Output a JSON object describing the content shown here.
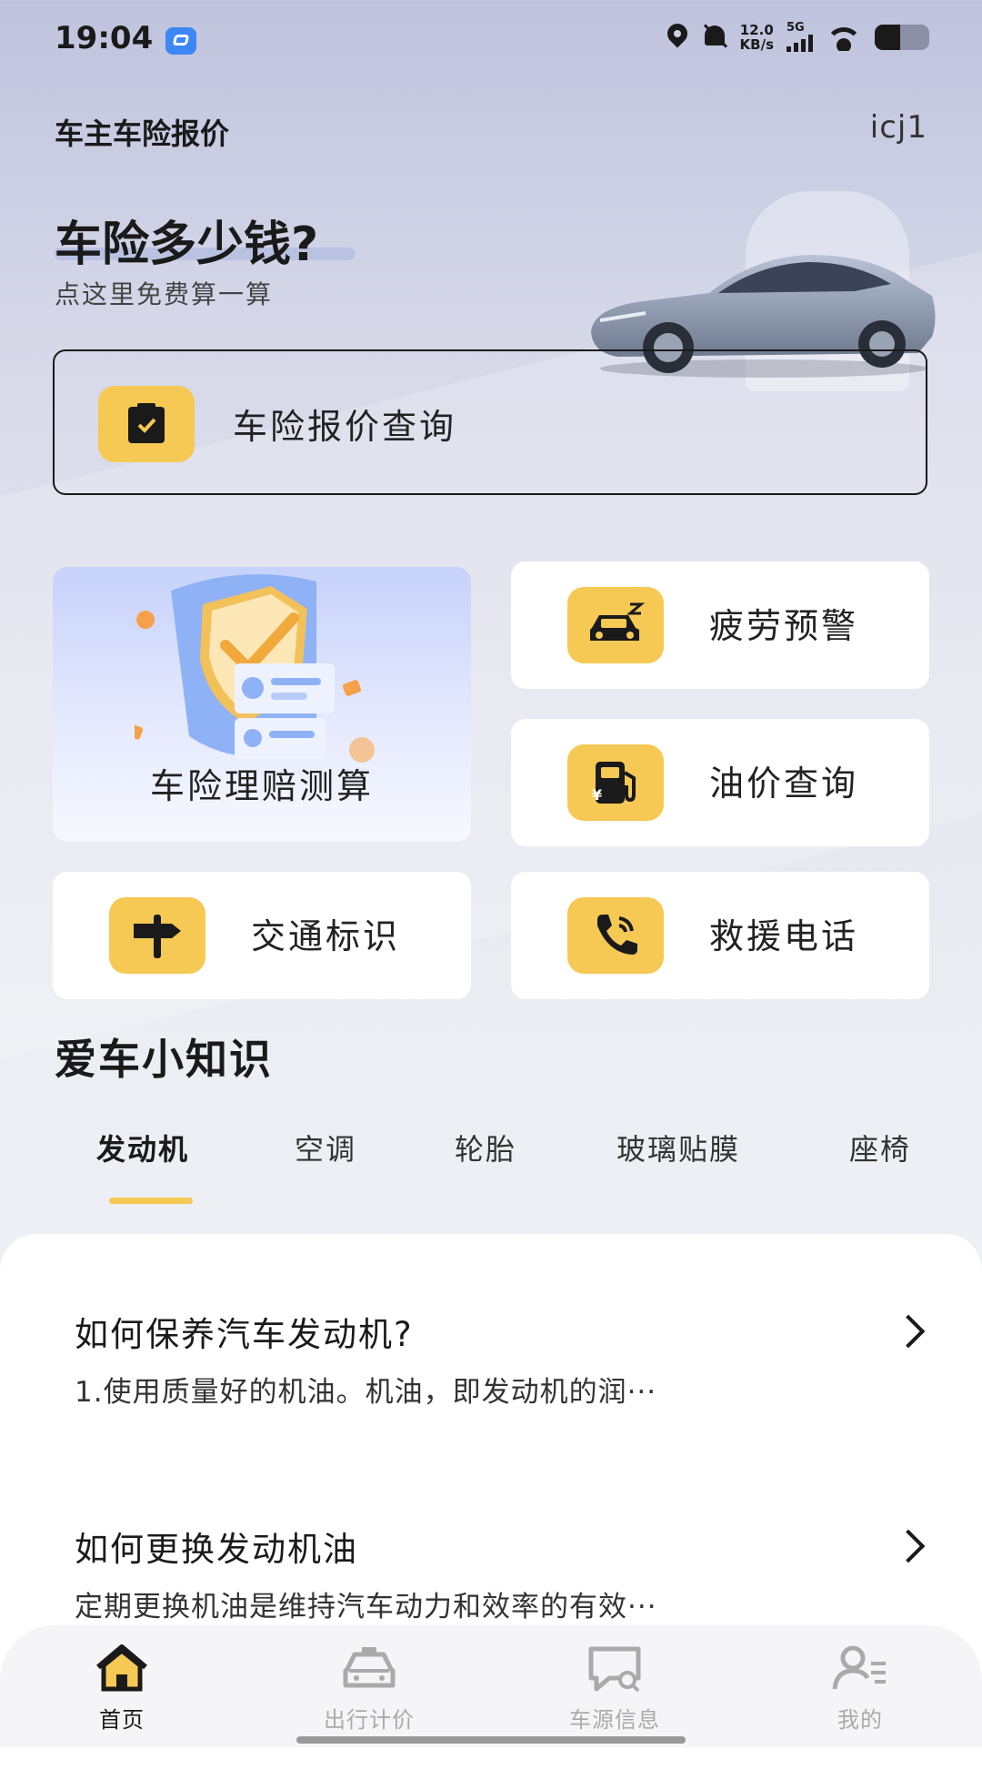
{
  "status_bar": {
    "time": "19:04",
    "net_speed_value": "12.0",
    "net_speed_unit": "KB/s",
    "signal_label": "5G"
  },
  "header": {
    "app_title": "车主车险报价",
    "user_id": "icj1"
  },
  "hero": {
    "title": "车险多少钱?",
    "subtitle": "点这里免费算一算"
  },
  "quote": {
    "label": "车险报价查询",
    "icon": "insurance-doc-icon"
  },
  "features": {
    "claim": {
      "label": "车险理赔测算"
    },
    "fatigue": {
      "label": "疲劳预警",
      "icon": "sleepy-car-icon"
    },
    "fuel": {
      "label": "油价查询",
      "icon": "fuel-pump-icon"
    },
    "traffic": {
      "label": "交通标识",
      "icon": "signpost-icon"
    },
    "rescue": {
      "label": "救援电话",
      "icon": "phone-icon"
    }
  },
  "knowledge": {
    "title": "爱车小知识",
    "tabs": [
      {
        "label": "发动机",
        "active": true
      },
      {
        "label": "空调",
        "active": false
      },
      {
        "label": "轮胎",
        "active": false
      },
      {
        "label": "玻璃贴膜",
        "active": false
      },
      {
        "label": "座椅",
        "active": false
      }
    ],
    "articles": [
      {
        "title": "如何保养汽车发动机?",
        "summary": "1.使用质量好的机油。机油，即发动机的润···"
      },
      {
        "title": "如何更换发动机油",
        "summary": "定期更换机油是维持汽车动力和效率的有效···"
      }
    ]
  },
  "bottom_nav": [
    {
      "label": "首页",
      "icon": "home-icon",
      "active": true
    },
    {
      "label": "出行计价",
      "icon": "car-icon",
      "active": false
    },
    {
      "label": "车源信息",
      "icon": "message-search-icon",
      "active": false
    },
    {
      "label": "我的",
      "icon": "user-icon",
      "active": false
    }
  ],
  "colors": {
    "accent_yellow": "#f6c955",
    "text_dark": "#1a1a1a",
    "nav_inactive": "#aaaaaa"
  }
}
